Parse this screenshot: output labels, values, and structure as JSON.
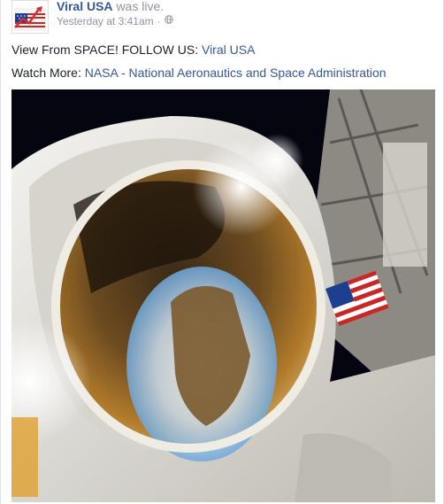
{
  "post": {
    "page_name": "Viral USA",
    "action_text": "was live.",
    "timestamp": "Yesterday at 3:41am",
    "separator": "·",
    "privacy_icon": "globe-icon",
    "line1_prefix": "View From SPACE! FOLLOW US: ",
    "line1_link": "Viral USA",
    "line2_prefix": "Watch More: ",
    "line2_link": "NASA - National Aeronautics and Space Administration"
  },
  "video": {
    "subject": "astronaut-selfie-spacewalk",
    "colors": {
      "space": "#050510",
      "suit": "#e8e6df",
      "visor_gold": "#b07a2a",
      "earth_blue": "#6fa8dc"
    }
  },
  "theme": {
    "link": "#365899",
    "muted": "#90949c",
    "text": "#1d2129"
  }
}
